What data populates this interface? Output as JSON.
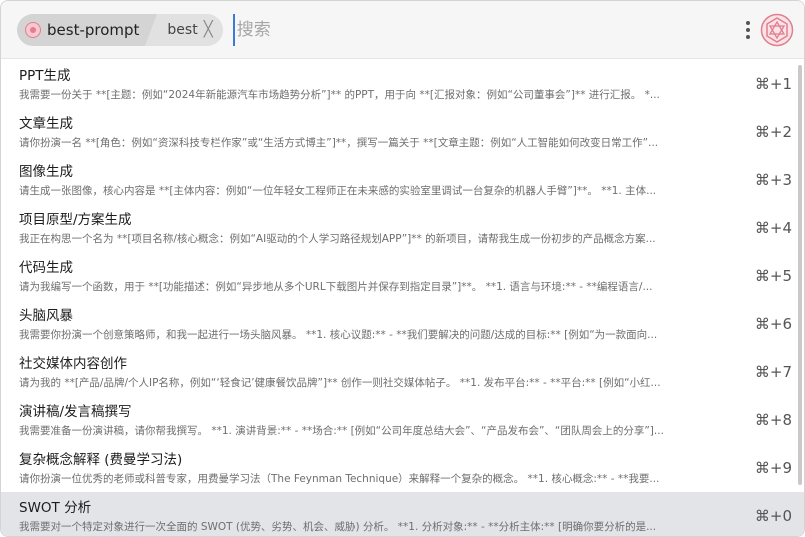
{
  "header": {
    "chip_primary_label": "best-prompt",
    "chip_secondary_label": "best",
    "chip_close_glyph": "╳",
    "search_placeholder": "搜索"
  },
  "icons": {
    "chip_logo": "pink-circle-logo-icon",
    "more": "vertical-ellipsis-icon",
    "app_logo": "pink-geometric-logo-icon",
    "chip_close": "close-icon"
  },
  "colors": {
    "accent": "#e07f8d",
    "selected_row": "#e2e4e8",
    "caret": "#3a7bd5"
  },
  "items": [
    {
      "title": "PPT生成",
      "desc": "我需要一份关于 **[主题：例如“2024年新能源汽车市场趋势分析”]** 的PPT，用于向 **[汇报对象：例如“公司董事会”]** 进行汇报。 *...",
      "shortcut": "⌘+1"
    },
    {
      "title": "文章生成",
      "desc": "请你扮演一名 **[角色：例如“资深科技专栏作家”或“生活方式博主”]**，撰写一篇关于 **[文章主题：例如“人工智能如何改变日常工作”...",
      "shortcut": "⌘+2"
    },
    {
      "title": "图像生成",
      "desc": "请生成一张图像，核心内容是 **[主体内容：例如“一位年轻女工程师正在未来感的实验室里调试一台复杂的机器人手臂”]**。 **1. 主体...",
      "shortcut": "⌘+3"
    },
    {
      "title": "项目原型/方案生成",
      "desc": "我正在构思一个名为 **[项目名称/核心概念：例如“AI驱动的个人学习路径规划APP”]** 的新项目，请帮我生成一份初步的产品概念方案...",
      "shortcut": "⌘+4"
    },
    {
      "title": "代码生成",
      "desc": "请为我编写一个函数，用于 **[功能描述：例如“异步地从多个URL下载图片并保存到指定目录”]**。 **1. 语言与环境:** - **编程语言/...",
      "shortcut": "⌘+5"
    },
    {
      "title": "头脑风暴",
      "desc": "我需要你扮演一个创意策略师，和我一起进行一场头脑风暴。 **1. 核心议题:** - **我们要解决的问题/达成的目标:** [例如“为一款面向...",
      "shortcut": "⌘+6"
    },
    {
      "title": "社交媒体内容创作",
      "desc": "请为我的 **[产品/品牌/个人IP名称，例如“‘轻食记’健康餐饮品牌”]** 创作一则社交媒体帖子。 **1. 发布平台:** - **平台:** [例如“小红...",
      "shortcut": "⌘+7"
    },
    {
      "title": "演讲稿/发言稿撰写",
      "desc": "我需要准备一份演讲稿，请你帮我撰写。 **1. 演讲背景:** - **场合:** [例如“公司年度总结大会”、“产品发布会”、“团队周会上的分享”]...",
      "shortcut": "⌘+8"
    },
    {
      "title": "复杂概念解释 (费曼学习法)",
      "desc": "请你扮演一位优秀的老师或科普专家，用费曼学习法（The Feynman Technique）来解释一个复杂的概念。 **1. 核心概念:** - **我要...",
      "shortcut": "⌘+9"
    },
    {
      "title": "SWOT 分析",
      "desc": "我需要对一个特定对象进行一次全面的 SWOT (优势、劣势、机会、威胁) 分析。 **1. 分析对象:** - **分析主体:** [明确你要分析的是...",
      "shortcut": "⌘+0",
      "selected": true
    }
  ]
}
